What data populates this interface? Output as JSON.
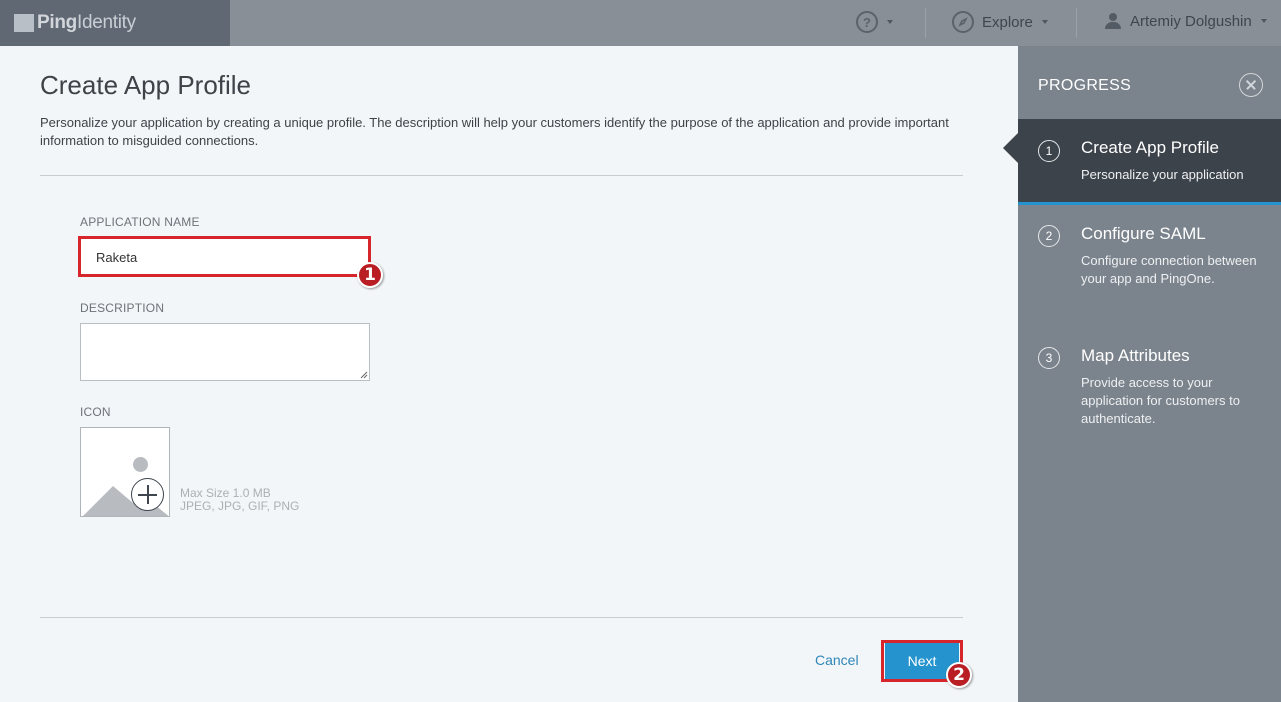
{
  "header": {
    "brand_bold": "Ping",
    "brand_light": "Identity",
    "help_icon": "question-circle-icon",
    "explore_label": "Explore",
    "user_name": "Artemiy Dolgushin"
  },
  "main": {
    "title": "Create App Profile",
    "description": "Personalize your application by creating a unique profile. The description will help your customers identify the purpose of the application and provide important information to misguided connections.",
    "app_name_label": "APPLICATION NAME",
    "app_name_value": "Raketa",
    "description_label": "DESCRIPTION",
    "description_value": "",
    "icon_label": "ICON",
    "icon_hint_size": "Max Size 1.0 MB",
    "icon_hint_types": "JPEG, JPG, GIF, PNG",
    "cancel_label": "Cancel",
    "next_label": "Next"
  },
  "annotations": [
    "1",
    "2"
  ],
  "sidebar": {
    "title": "PROGRESS",
    "steps": [
      {
        "num": "1",
        "title": "Create App Profile",
        "desc": "Personalize your application",
        "active": true
      },
      {
        "num": "2",
        "title": "Configure SAML",
        "desc": "Configure connection between your app and PingOne.",
        "active": false
      },
      {
        "num": "3",
        "title": "Map Attributes",
        "desc": "Provide access to your application for customers to authenticate.",
        "active": false
      }
    ]
  },
  "colors": {
    "accent": "#2593cd",
    "annotation_red": "#d7262b",
    "sidebar_bg": "#7b838c",
    "active_step_bg": "#3d434b"
  }
}
